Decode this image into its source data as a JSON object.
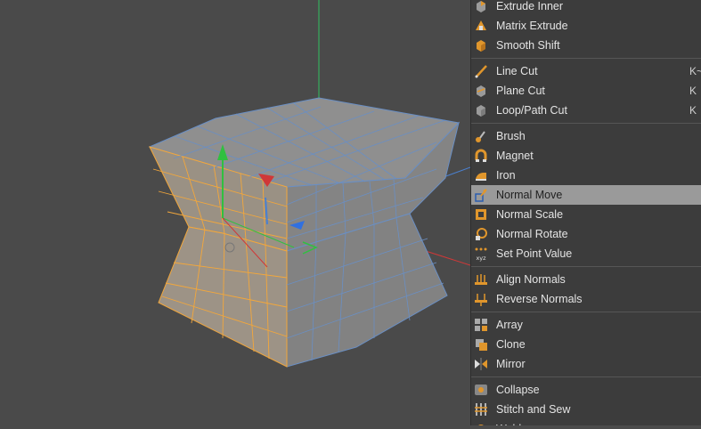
{
  "menu": {
    "groups": [
      [
        {
          "label": "Extrude Inner",
          "icon": "extrude-inner-icon"
        },
        {
          "label": "Matrix Extrude",
          "icon": "matrix-extrude-icon"
        },
        {
          "label": "Smooth Shift",
          "icon": "smooth-shift-icon"
        }
      ],
      [
        {
          "label": "Line Cut",
          "icon": "line-cut-icon",
          "shortcut": "K~"
        },
        {
          "label": "Plane Cut",
          "icon": "plane-cut-icon",
          "shortcut": "K"
        },
        {
          "label": "Loop/Path Cut",
          "icon": "loop-path-cut-icon",
          "shortcut": "K"
        }
      ],
      [
        {
          "label": "Brush",
          "icon": "brush-icon"
        },
        {
          "label": "Magnet",
          "icon": "magnet-icon"
        },
        {
          "label": "Iron",
          "icon": "iron-icon"
        },
        {
          "label": "Normal Move",
          "icon": "normal-move-icon",
          "active": true
        },
        {
          "label": "Normal Scale",
          "icon": "normal-scale-icon"
        },
        {
          "label": "Normal Rotate",
          "icon": "normal-rotate-icon"
        },
        {
          "label": "Set Point Value",
          "icon": "set-point-value-icon",
          "icon_text": "xyz"
        }
      ],
      [
        {
          "label": "Align Normals",
          "icon": "align-normals-icon"
        },
        {
          "label": "Reverse Normals",
          "icon": "reverse-normals-icon"
        }
      ],
      [
        {
          "label": "Array",
          "icon": "array-icon"
        },
        {
          "label": "Clone",
          "icon": "clone-icon"
        },
        {
          "label": "Mirror",
          "icon": "mirror-icon"
        }
      ],
      [
        {
          "label": "Collapse",
          "icon": "collapse-icon"
        },
        {
          "label": "Stitch and Sew",
          "icon": "stitch-and-sew-icon"
        },
        {
          "label": "Weld",
          "icon": "weld-icon"
        }
      ]
    ]
  },
  "colors": {
    "accent": "#f0a030",
    "active_bg": "#9a9a9a",
    "menu_bg": "#3c3c3c",
    "viewport_bg": "#4a4a4a",
    "mesh_face": "#8b8b8b",
    "wire_selected": "#f3a73b",
    "wire_unselected": "#6a8fc4",
    "axis_x": "#e03030",
    "axis_y": "#30c040",
    "axis_z": "#3070e0"
  }
}
